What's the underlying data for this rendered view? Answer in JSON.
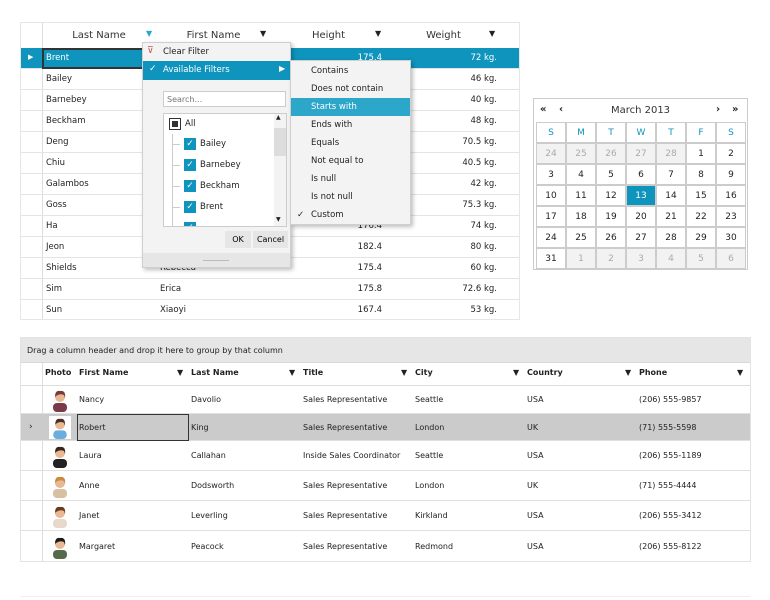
{
  "top_grid": {
    "columns": [
      "Last Name",
      "First Name",
      "Height",
      "Weight"
    ],
    "rows": [
      {
        "last": "Brent",
        "first": "",
        "height": "175.4",
        "weight": "72 kg."
      },
      {
        "last": "Bailey",
        "first": "",
        "height": "",
        "weight": "46 kg."
      },
      {
        "last": "Barnebey",
        "first": "",
        "height": "",
        "weight": "40 kg."
      },
      {
        "last": "Beckham",
        "first": "",
        "height": "",
        "weight": "48 kg."
      },
      {
        "last": "Deng",
        "first": "",
        "height": "",
        "weight": "70.5 kg."
      },
      {
        "last": "Chiu",
        "first": "",
        "height": "",
        "weight": "40.5 kg."
      },
      {
        "last": "Galambos",
        "first": "",
        "height": "",
        "weight": "42 kg."
      },
      {
        "last": "Goss",
        "first": "",
        "height": "",
        "weight": "75.3 kg."
      },
      {
        "last": "Ha",
        "first": "",
        "height": "176.4",
        "weight": "74 kg."
      },
      {
        "last": "Jeon",
        "first": "",
        "height": "182.4",
        "weight": "80 kg."
      },
      {
        "last": "Shields",
        "first": "Rebecca",
        "height": "175.4",
        "weight": "60 kg."
      },
      {
        "last": "Sim",
        "first": "Erica",
        "height": "175.8",
        "weight": "72.6 kg."
      },
      {
        "last": "Sun",
        "first": "Xiaoyi",
        "height": "167.4",
        "weight": "53 kg."
      }
    ]
  },
  "filter_popup": {
    "clear_filter": "Clear Filter",
    "available_filters": "Available Filters",
    "search_placeholder": "Search...",
    "all_label": "All",
    "items": [
      "Bailey",
      "Barnebey",
      "Beckham",
      "Brent"
    ],
    "ok": "OK",
    "cancel": "Cancel",
    "submenu": [
      "Contains",
      "Does not contain",
      "Starts with",
      "Ends with",
      "Equals",
      "Not equal to",
      "Is null",
      "Is not null",
      "Custom"
    ],
    "highlighted": "Starts with",
    "checked": "Custom"
  },
  "calendar": {
    "title": "March 2013",
    "days": [
      "S",
      "M",
      "T",
      "W",
      "T",
      "F",
      "S"
    ],
    "weeks": [
      [
        "24",
        "25",
        "26",
        "27",
        "28",
        "1",
        "2"
      ],
      [
        "3",
        "4",
        "5",
        "6",
        "7",
        "8",
        "9"
      ],
      [
        "10",
        "11",
        "12",
        "13",
        "14",
        "15",
        "16"
      ],
      [
        "17",
        "18",
        "19",
        "20",
        "21",
        "22",
        "23"
      ],
      [
        "24",
        "25",
        "26",
        "27",
        "28",
        "29",
        "30"
      ],
      [
        "31",
        "1",
        "2",
        "3",
        "4",
        "5",
        "6"
      ]
    ],
    "selected": "13"
  },
  "bottom_grid": {
    "group_panel": "Drag a column header and drop it here to group by that column",
    "columns": [
      "Photo",
      "First Name",
      "Last Name",
      "Title",
      "City",
      "Country",
      "Phone"
    ],
    "rows": [
      {
        "first": "Nancy",
        "last": "Davolio",
        "title": "Sales Representative",
        "city": "Seattle",
        "country": "USA",
        "phone": "(206) 555-9857"
      },
      {
        "first": "Robert",
        "last": "King",
        "title": "Sales Representative",
        "city": "London",
        "country": "UK",
        "phone": "(71) 555-5598"
      },
      {
        "first": "Laura",
        "last": "Callahan",
        "title": "Inside Sales Coordinator",
        "city": "Seattle",
        "country": "USA",
        "phone": "(206) 555-1189"
      },
      {
        "first": "Anne",
        "last": "Dodsworth",
        "title": "Sales Representative",
        "city": "London",
        "country": "UK",
        "phone": "(71) 555-4444"
      },
      {
        "first": "Janet",
        "last": "Leverling",
        "title": "Sales Representative",
        "city": "Kirkland",
        "country": "USA",
        "phone": "(206) 555-3412"
      },
      {
        "first": "Margaret",
        "last": "Peacock",
        "title": "Sales Representative",
        "city": "Redmond",
        "country": "USA",
        "phone": "(206) 555-8122"
      }
    ]
  },
  "colors": {
    "accent": "#0f94bd",
    "selected_row_gray": "#cbcbcb"
  }
}
